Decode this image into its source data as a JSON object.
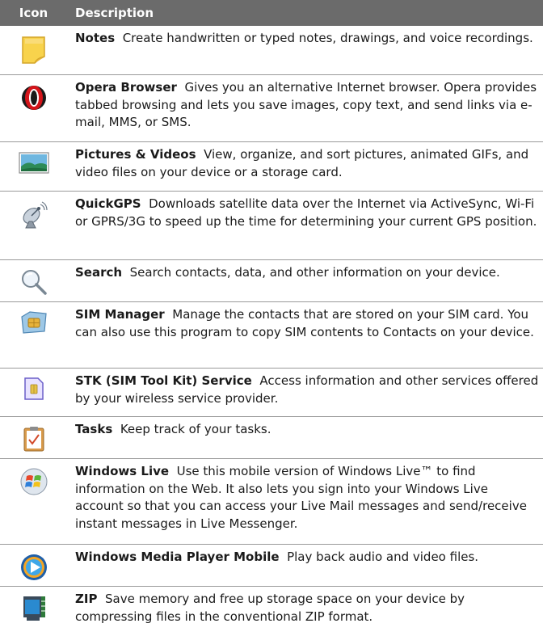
{
  "header": {
    "icon": "Icon",
    "description": "Description"
  },
  "rows": [
    {
      "icon": "notes-icon",
      "name": "Notes",
      "text": "Create handwritten or typed notes, drawings, and voice recordings."
    },
    {
      "icon": "opera-icon",
      "name": "Opera Browser",
      "text": "Gives you an alternative Internet browser. Opera provides tabbed browsing and lets you save images, copy text, and send links via e-mail, MMS, or SMS."
    },
    {
      "icon": "pictures-icon",
      "name": "Pictures & Videos",
      "text": "View, organize, and sort pictures, animated GIFs, and video files on your device or a storage card."
    },
    {
      "icon": "satellite-dish-icon",
      "name": "QuickGPS",
      "text": "Downloads satellite data over the Internet via ActiveSync, Wi-Fi or GPRS/3G to speed up the time for determining your current GPS position."
    },
    {
      "icon": "magnifier-icon",
      "name": "Search",
      "text": "Search contacts, data, and other information on your device."
    },
    {
      "icon": "sim-manager-icon",
      "name": "SIM Manager",
      "text": "Manage the contacts that are stored on your SIM card. You can also use this program to copy SIM contents to Contacts on your device."
    },
    {
      "icon": "sim-card-icon",
      "name": "STK (SIM Tool Kit) Service",
      "text": "Access information and other services offered by your wireless service provider."
    },
    {
      "icon": "clipboard-check-icon",
      "name": "Tasks",
      "text": "Keep track of your tasks."
    },
    {
      "icon": "windows-live-icon",
      "name": "Windows Live",
      "text": "Use this mobile version of Windows Live™ to find information on the Web. It also lets you sign into your Windows Live account so that you can access your Live Mail messages and send/receive instant messages in Live Messenger."
    },
    {
      "icon": "media-player-icon",
      "name": "Windows Media Player Mobile",
      "text": "Play back audio and video files."
    },
    {
      "icon": "zip-icon",
      "name": "ZIP",
      "text": "Save memory and free up storage space on your device by compressing files in the conventional ZIP format."
    }
  ]
}
